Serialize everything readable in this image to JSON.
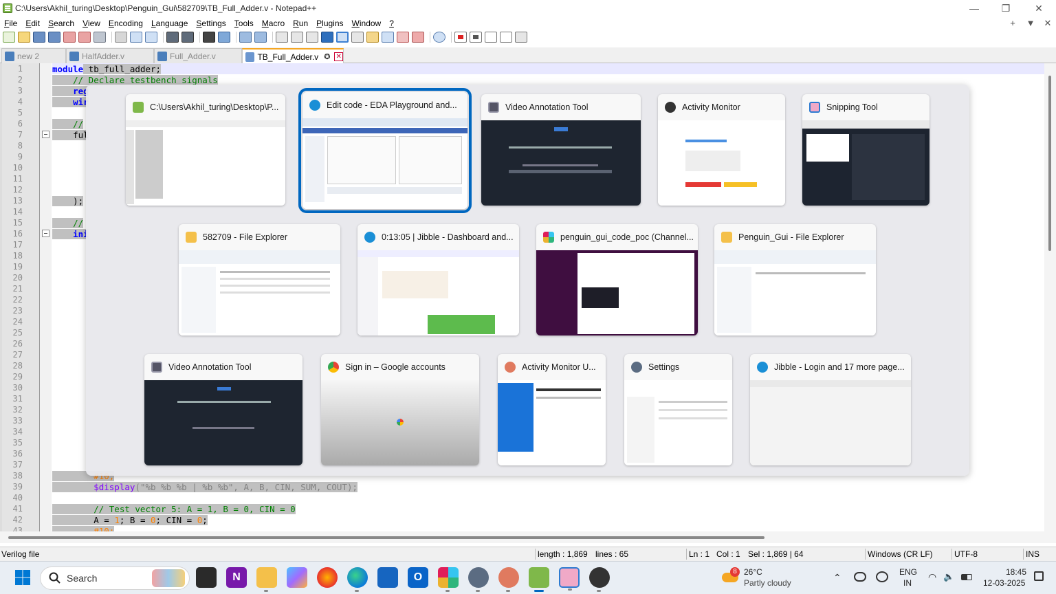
{
  "window": {
    "title": "C:\\Users\\Akhil_turing\\Desktop\\Penguin_Gui\\582709\\TB_Full_Adder.v - Notepad++",
    "minimize": "—",
    "maximize": "❐",
    "close": "✕"
  },
  "menu": {
    "items": [
      {
        "u": "F",
        "rest": "ile"
      },
      {
        "u": "E",
        "rest": "dit"
      },
      {
        "u": "S",
        "rest": "earch"
      },
      {
        "u": "V",
        "rest": "iew"
      },
      {
        "u": "E",
        "rest": "ncoding"
      },
      {
        "u": "L",
        "rest": "anguage"
      },
      {
        "u": "S",
        "rest": "ettings"
      },
      {
        "u": "T",
        "rest": "ools"
      },
      {
        "u": "M",
        "rest": "acro"
      },
      {
        "u": "R",
        "rest": "un"
      },
      {
        "u": "P",
        "rest": "lugins"
      },
      {
        "u": "W",
        "rest": "indow"
      },
      {
        "u": "?",
        "rest": ""
      }
    ],
    "right": [
      "+",
      "▼",
      "✕"
    ]
  },
  "tabs": [
    {
      "label": "new 2"
    },
    {
      "label": "HalfAdder.v"
    },
    {
      "label": "Full_Adder.v"
    },
    {
      "label": "TB_Full_Adder.v",
      "pin": "✪",
      "close": "✕"
    }
  ],
  "editor": {
    "line_numbers": [
      "1",
      "2",
      "3",
      "4",
      "5",
      "6",
      "7",
      "8",
      "9",
      "10",
      "11",
      "12",
      "13",
      "14",
      "15",
      "16",
      "17",
      "18",
      "19",
      "20",
      "21",
      "22",
      "23",
      "24",
      "25",
      "26",
      "27",
      "28",
      "29",
      "30",
      "31",
      "32",
      "33",
      "34",
      "35",
      "36",
      "37",
      "38",
      "39",
      "40",
      "41",
      "42",
      "43"
    ],
    "visible_code": {
      "l1_kw": "module",
      "l1_rest": " tb_full_adder;",
      "l2": "    // Declare testbench signals",
      "l3": "    reg",
      "l4": "    wir",
      "l6": "    //",
      "l7": "    ful",
      "l13": "    );",
      "l15": "    //",
      "l16": "    ini",
      "l38": "        #10;",
      "l39_fn": "        $display",
      "l39_rest": "(\"%b %b %b | %b %b\", A, B, CIN, SUM, COUT);",
      "l41": "        // Test vector 5: A = 1, B = 0, CIN = 0",
      "l42_a": "        A = ",
      "l42_1": "1",
      "l42_b": "; B = ",
      "l42_0": "0",
      "l42_c": "; CIN = ",
      "l42_0b": "0",
      "l42_d": ";",
      "l43": "        #10;"
    }
  },
  "task_switcher": {
    "windows": [
      {
        "title": "C:\\Users\\Akhil_turing\\Desktop\\P...",
        "icon": "notepadpp-icon"
      },
      {
        "title": "Edit code - EDA Playground and...",
        "icon": "edge-icon",
        "selected": true
      },
      {
        "title": "Video Annotation Tool",
        "icon": "app-window-icon"
      },
      {
        "title": "Activity Monitor",
        "icon": "activity-monitor-icon"
      },
      {
        "title": "Snipping Tool",
        "icon": "snipping-tool-icon"
      },
      {
        "title": "582709 - File Explorer",
        "icon": "folder-icon"
      },
      {
        "title": "0:13:05 | Jibble - Dashboard and...",
        "icon": "edge-icon"
      },
      {
        "title": "penguin_gui_code_poc (Channel...",
        "icon": "slack-icon"
      },
      {
        "title": "Penguin_Gui - File Explorer",
        "icon": "folder-icon"
      },
      {
        "title": "Video Annotation Tool",
        "icon": "app-window-icon"
      },
      {
        "title": "Sign in – Google accounts",
        "icon": "chrome-icon"
      },
      {
        "title": "Activity Monitor U...",
        "icon": "activity-monitor-icon"
      },
      {
        "title": "Settings",
        "icon": "gear-icon"
      },
      {
        "title": "Jibble - Login and 17 more page...",
        "icon": "edge-icon"
      }
    ]
  },
  "status": {
    "file_type": "Verilog file",
    "length": "length : 1,869",
    "lines": "lines : 65",
    "ln": "Ln : 1",
    "col": "Col : 1",
    "sel": "Sel : 1,869 | 64",
    "eol": "Windows (CR LF)",
    "encoding": "UTF-8",
    "mode": "INS"
  },
  "taskbar": {
    "search_placeholder": "Search",
    "weather_temp": "26°C",
    "weather_desc": "Partly cloudy",
    "weather_badge": "8",
    "lang_1": "ENG",
    "lang_2": "IN",
    "time": "18:45",
    "date": "12-03-2025"
  },
  "colors": {
    "accent": "#0067c0",
    "keyword": "#0000ff",
    "comment": "#008000",
    "selection": "#c0c0c0"
  }
}
